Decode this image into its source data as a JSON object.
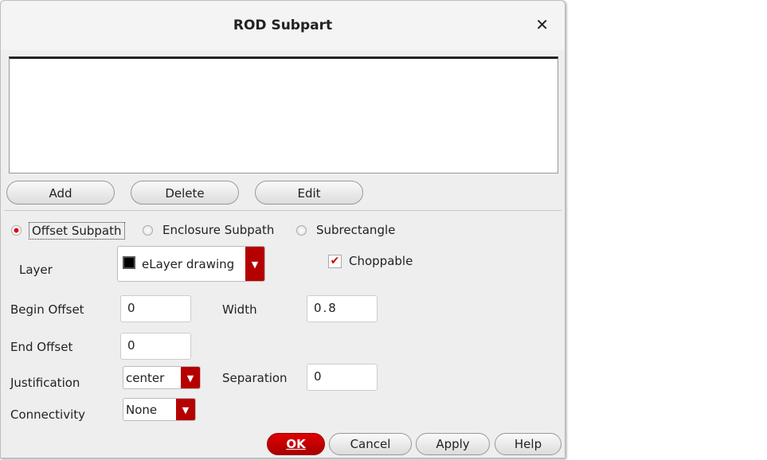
{
  "title": "ROD Subpart",
  "list_buttons": {
    "add": "Add",
    "delete": "Delete",
    "edit": "Edit"
  },
  "mode_options": [
    "Offset Subpath",
    "Enclosure Subpath",
    "Subrectangle"
  ],
  "selected_mode": "Offset Subpath",
  "layer": {
    "label": "Layer",
    "value": "eLayer drawing"
  },
  "choppable": {
    "label": "Choppable",
    "checked": true
  },
  "begin_offset": {
    "label": "Begin Offset",
    "value": "0"
  },
  "width": {
    "label": "Width",
    "value": "0.8"
  },
  "end_offset": {
    "label": "End Offset",
    "value": "0"
  },
  "justification": {
    "label": "Justification",
    "value": "center"
  },
  "separation": {
    "label": "Separation",
    "value": "0"
  },
  "connectivity": {
    "label": "Connectivity",
    "value": "None"
  },
  "footer": {
    "ok": "OK",
    "cancel": "Cancel",
    "apply": "Apply",
    "help": "Help"
  },
  "colors": {
    "accent": "#b50000"
  }
}
